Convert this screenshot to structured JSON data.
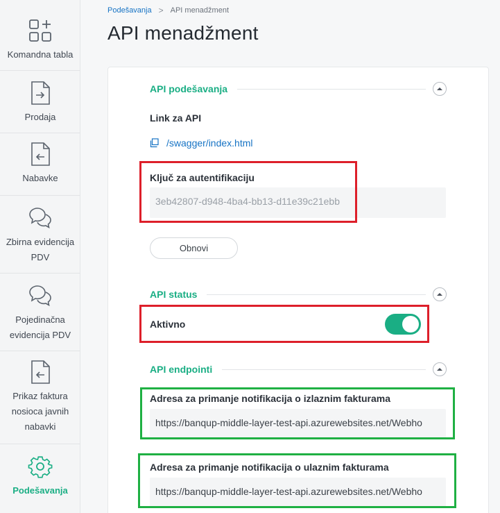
{
  "sidebar": {
    "items": [
      {
        "label": "Komandna tabla",
        "icon": "dashboard-grid-icon"
      },
      {
        "label": "Prodaja",
        "icon": "document-arrow-right-icon"
      },
      {
        "label": "Nabavke",
        "icon": "document-arrow-left-icon"
      },
      {
        "label": "Zbirna evidencija\nPDV",
        "icon": "chat-bubbles-icon"
      },
      {
        "label": "Pojedinačna\nevidencija PDV",
        "icon": "chat-bubbles-icon"
      },
      {
        "label": "Prikaz faktura\nnosioca javnih\nnabavki",
        "icon": "document-arrow-left-icon"
      },
      {
        "label": "Podešavanja",
        "icon": "gear-icon",
        "active": true
      }
    ]
  },
  "breadcrumb": {
    "parent": "Podešavanja",
    "separator": ">",
    "current": "API menadžment"
  },
  "page_title": "API menadžment",
  "api_settings": {
    "title": "API podešavanja",
    "link_label": "Link za API",
    "link_text": "/swagger/index.html",
    "auth_label": "Ključ za autentifikaciju",
    "auth_value": "3eb42807-d948-4ba4-bb13-d11e39c21ebb",
    "renew_button": "Obnovi"
  },
  "api_status": {
    "title": "API status",
    "label": "Aktivno",
    "enabled": true
  },
  "api_endpoints": {
    "title": "API endpointi",
    "outgoing_label": "Adresa za primanje notifikacija o izlaznim fakturama",
    "outgoing_value": "https://banqup-middle-layer-test-api.azurewebsites.net/Webho",
    "incoming_label": "Adresa za primanje notifikacija o ulaznim fakturama",
    "incoming_value": "https://banqup-middle-layer-test-api.azurewebsites.net/Webho"
  },
  "colors": {
    "accent": "#1aae84",
    "link": "#1673c4",
    "highlight_red": "#dd1f2a",
    "highlight_green": "#1fb043"
  }
}
